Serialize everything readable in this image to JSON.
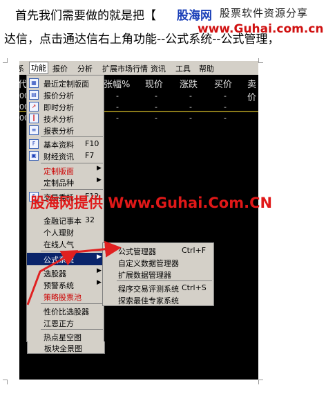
{
  "intro": {
    "line1": "首先我们需要做的就是把【",
    "line2": "达信，点击通达信右上角功能--公式系统--公式管理，"
  },
  "logo": {
    "name": "股海网",
    "slogan": "股票软件资源分享",
    "url": "www.Guhai.com.cn"
  },
  "watermark": "股海网提供 Www.Guhai.Com.CN",
  "menubar": [
    "系",
    "功能",
    "报价",
    "分析",
    "扩展市场行情",
    "资讯",
    "工具",
    "帮助"
  ],
  "columns": [
    "代",
    "张幅%",
    "现价",
    "涨跌",
    "买价",
    "卖价"
  ],
  "row_numbers": [
    "00",
    "00",
    "00"
  ],
  "dash": "-",
  "function_menu": {
    "items": [
      {
        "label": "最近定制版面",
        "icon": "layout",
        "shortcut": "",
        "submenu": false
      },
      {
        "label": "报价分析",
        "icon": "grid",
        "shortcut": "",
        "submenu": false
      },
      {
        "label": "即时分析",
        "icon": "line",
        "shortcut": "",
        "submenu": false
      },
      {
        "label": "技术分析",
        "icon": "candle",
        "shortcut": "",
        "submenu": false
      },
      {
        "label": "报表分析",
        "icon": "report",
        "shortcut": "",
        "submenu": false
      },
      {
        "label": "基本资料",
        "icon": "F10",
        "shortcut": "F10",
        "submenu": false
      },
      {
        "label": "财经资讯",
        "icon": "news",
        "shortcut": "F7",
        "submenu": false
      },
      {
        "label": "定制版面",
        "icon": "",
        "shortcut": "",
        "submenu": true,
        "color": "#cc0000"
      },
      {
        "label": "定制品种",
        "icon": "",
        "shortcut": "",
        "submenu": true
      },
      {
        "label": "交易委托",
        "icon": "F12",
        "shortcut": "F12",
        "submenu": false
      },
      {
        "label": "金融记事本",
        "icon": "",
        "shortcut": "32",
        "submenu": false
      },
      {
        "label": "个人理财",
        "icon": "",
        "shortcut": "",
        "submenu": false
      },
      {
        "label": "在线人气",
        "icon": "",
        "shortcut": "",
        "submenu": false
      },
      {
        "label": "公式系统",
        "icon": "",
        "shortcut": "",
        "submenu": true,
        "highlighted": true
      },
      {
        "label": "选股器",
        "icon": "",
        "shortcut": "",
        "submenu": true
      },
      {
        "label": "预警系统",
        "icon": "",
        "shortcut": "",
        "submenu": true
      },
      {
        "label": "策略股票池",
        "icon": "",
        "shortcut": "",
        "submenu": false,
        "color": "#cc0000"
      },
      {
        "label": "性价比选股器",
        "icon": "",
        "shortcut": "",
        "submenu": false
      },
      {
        "label": "江恩正方",
        "icon": "",
        "shortcut": "",
        "submenu": false
      },
      {
        "label": "热点星空图",
        "icon": "",
        "shortcut": "",
        "submenu": false
      },
      {
        "label": "板块全景图",
        "icon": "",
        "shortcut": "",
        "submenu": false
      }
    ]
  },
  "formula_submenu": {
    "items": [
      {
        "label": "公式管理器",
        "shortcut": "Ctrl+F"
      },
      {
        "label": "自定义数据管理器",
        "shortcut": ""
      },
      {
        "label": "扩展数据管理器",
        "shortcut": ""
      },
      {
        "label": "程序交易评测系统",
        "shortcut": "Ctrl+S"
      },
      {
        "label": "探索最佳专家系统",
        "shortcut": ""
      }
    ]
  },
  "colors": {
    "arrow": "#e02020",
    "menu_bg": "#d4d0c8",
    "highlight": "#0a246a"
  }
}
